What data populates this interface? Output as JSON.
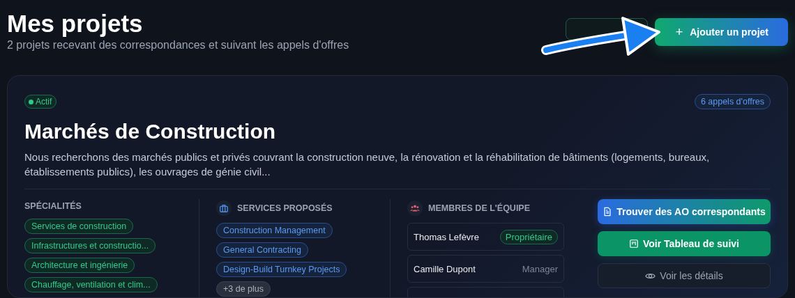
{
  "header": {
    "title": "Mes projets",
    "subtitle": "2 projets recevant des correspondances et suivant les appels d'offres",
    "add_button": {
      "icon": "+",
      "label": "Ajouter un projet"
    }
  },
  "project": {
    "status": {
      "label": "Actif",
      "active": true
    },
    "tender_count": "6 appels d'offres",
    "title": "Marchés de Construction",
    "description": "Nous recherchons des marchés publics et privés couvrant la construction neuve, la rénovation et la réhabilitation de bâtiments (logements, bureaux, établissements publics), les ouvrages de génie civil...",
    "specialties": {
      "heading": "SPÉCIALITÉS",
      "tags": [
        "Services de construction",
        "Infrastructures et constructio...",
        "Architecture et ingénierie",
        "Chauffage, ventilation et clim..."
      ]
    },
    "services": {
      "heading": "SERVICES PROPOSÉS",
      "tags": [
        {
          "label": "Construction Management",
          "kind": "service"
        },
        {
          "label": "General Contracting",
          "kind": "service"
        },
        {
          "label": "Design-Build Turnkey Projects",
          "kind": "service"
        },
        {
          "label": "+3 de plus",
          "kind": "more"
        }
      ]
    },
    "team": {
      "heading": "MEMBRES DE L'ÉQUIPE",
      "members": [
        {
          "name": "Thomas Lefèvre",
          "role": "Propriétaire",
          "owner": true
        },
        {
          "name": "Camille Dupont",
          "role": "Manager",
          "owner": false
        }
      ]
    },
    "actions": [
      {
        "label": "Trouver des AO correspondants",
        "kind": "find"
      },
      {
        "label": "Voir Tableau de suivi",
        "kind": "board"
      },
      {
        "label": "Voir les détails",
        "kind": "details"
      }
    ]
  }
}
